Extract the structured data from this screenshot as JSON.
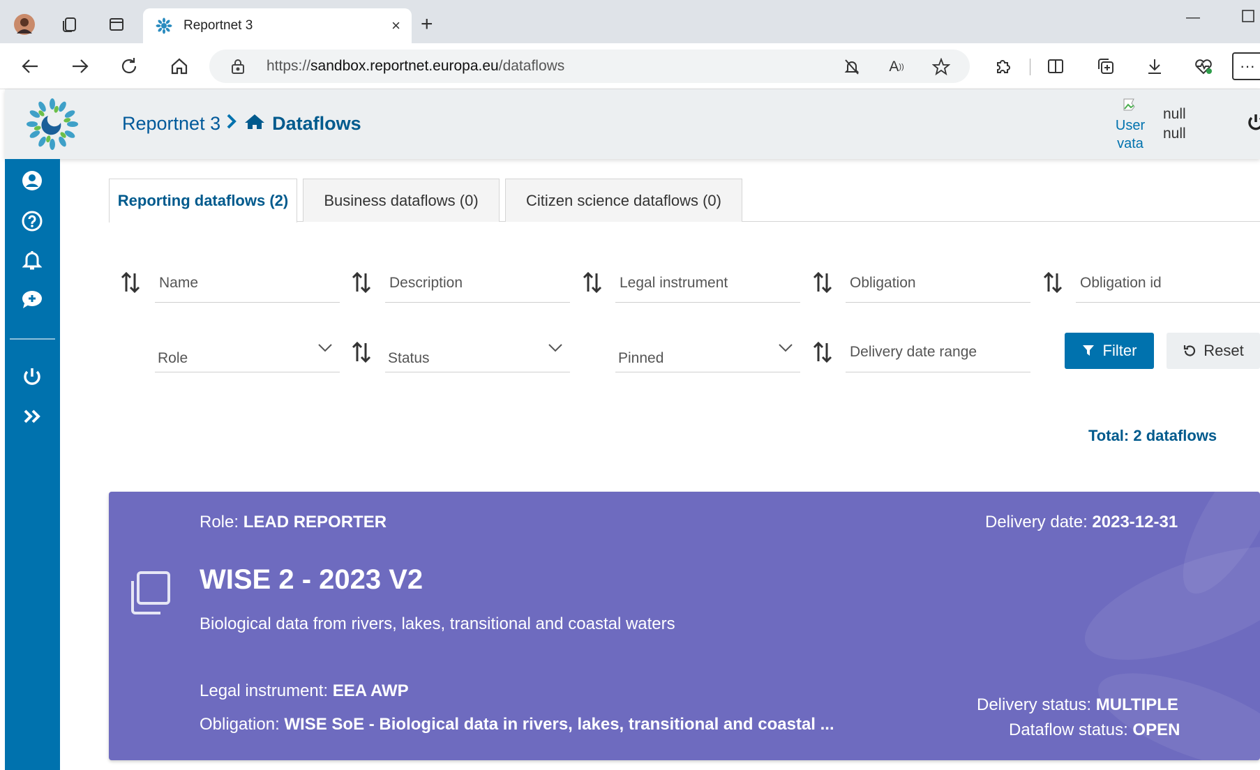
{
  "browser": {
    "tab_title": "Reportnet 3",
    "url_prefix": "https://",
    "url_host": "sandbox.reportnet.europa.eu",
    "url_path": "/dataflows",
    "tab_close": "×",
    "new_tab": "+",
    "more": "···"
  },
  "header": {
    "breadcrumb_root": "Reportnet 3",
    "breadcrumb_current": "Dataflows",
    "user_avatar_alt_line1": "User",
    "user_avatar_alt_line2": "vata",
    "user_first_name": "null",
    "user_last_name": "null"
  },
  "tabs": [
    {
      "label": "Reporting dataflows (2)",
      "active": true
    },
    {
      "label": "Business dataflows (0)",
      "active": false
    },
    {
      "label": "Citizen science dataflows (0)",
      "active": false
    }
  ],
  "filters": {
    "name": "Name",
    "description": "Description",
    "legal_instrument": "Legal instrument",
    "obligation": "Obligation",
    "obligation_id": "Obligation id",
    "role": "Role",
    "status": "Status",
    "pinned": "Pinned",
    "delivery_date_range": "Delivery date range",
    "filter_button": "Filter",
    "reset_button": "Reset"
  },
  "total_label": "Total: 2 dataflows",
  "card": {
    "role_label": "Role: ",
    "role_value": "LEAD REPORTER",
    "delivery_date_label": "Delivery date: ",
    "delivery_date_value": "2023-12-31",
    "title": "WISE 2 - 2023 V2",
    "description": "Biological data from rivers, lakes, transitional and coastal waters",
    "legal_label": "Legal instrument: ",
    "legal_value": "EEA AWP",
    "obligation_label": "Obligation: ",
    "obligation_value": "WISE SoE - Biological data in rivers, lakes, transitional and coastal ...",
    "delivery_status_label": "Delivery status: ",
    "delivery_status_value": "MULTIPLE",
    "dataflow_status_label": "Dataflow status: ",
    "dataflow_status_value": "OPEN",
    "color": "#6e6bbf"
  },
  "colors": {
    "primary": "#0072ae",
    "primary_dark": "#005a8d",
    "header_bg": "#eceff1"
  }
}
